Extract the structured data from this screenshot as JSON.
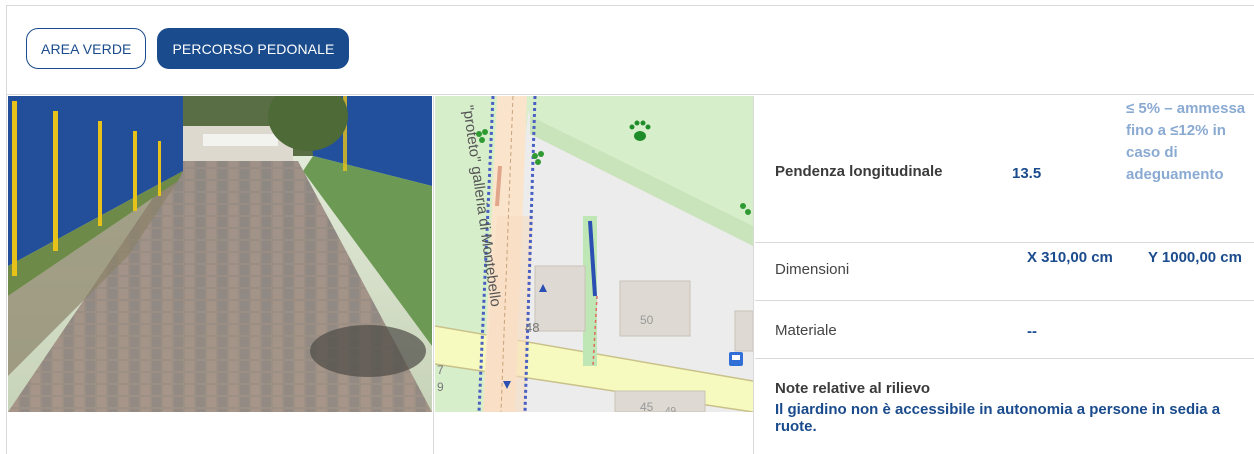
{
  "tabs": [
    {
      "label": "AREA VERDE",
      "active": false
    },
    {
      "label": "PERCORSO PEDONALE",
      "active": true
    }
  ],
  "photo": {
    "description_icon": "photo-image"
  },
  "map": {
    "street_label": "\"proteto\" galleria di Montebello",
    "house_numbers": [
      "48",
      "50",
      "45",
      "7",
      "9",
      "49"
    ],
    "icons": [
      "dog-park-icon",
      "tree-icon",
      "bus-stop-icon"
    ]
  },
  "table": {
    "rows": [
      {
        "label": "Pendenza longitudinale",
        "value1": "13.5",
        "value2": "≤ 5% – ammessa fino a ≤12% in caso di adeguamento"
      },
      {
        "label": "Dimensioni",
        "value1": "X 310,00 cm",
        "value2": "Y 1000,00 cm"
      },
      {
        "label": "Materiale",
        "value1": "--",
        "value2": ""
      }
    ],
    "note_title": "Note relative al rilievo",
    "note_text": "Il giardino non è accessibile in autonomia a persone in sedia a ruote."
  },
  "colors": {
    "accent": "#1a4b8c",
    "light_accent": "#8aaad2",
    "border": "#d9d9d9"
  }
}
